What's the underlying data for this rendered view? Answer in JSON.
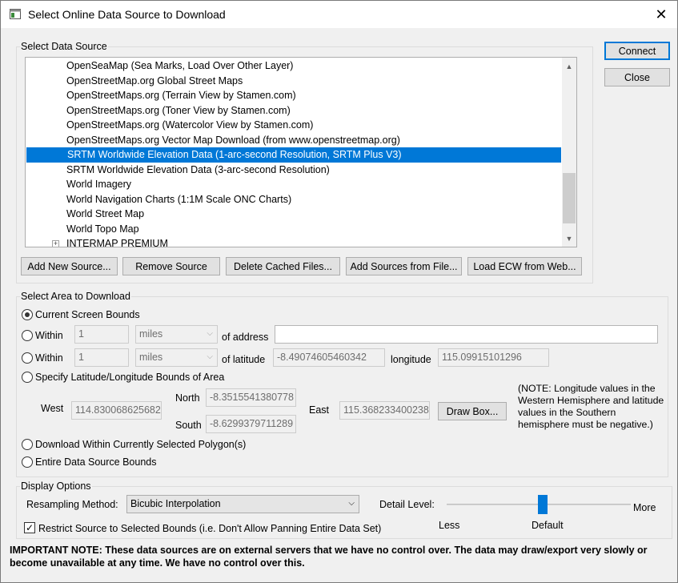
{
  "window": {
    "title": "Select Online Data Source to Download",
    "close_glyph": "✕",
    "icon": "app-window-icon"
  },
  "buttons": {
    "connect": "Connect",
    "close": "Close",
    "add_new_source": "Add New Source...",
    "remove_source": "Remove Source",
    "delete_cached": "Delete Cached Files...",
    "add_from_file": "Add Sources from File...",
    "load_ecw": "Load ECW from Web...",
    "draw_box": "Draw Box..."
  },
  "data_source": {
    "label": "Select Data Source",
    "items": [
      "OpenSeaMap (Sea Marks, Load Over Other Layer)",
      "OpenStreetMap.org Global Street Maps",
      "OpenStreetMaps.org (Terrain View by Stamen.com)",
      "OpenStreetMaps.org (Toner View by Stamen.com)",
      "OpenStreetMaps.org (Watercolor View by Stamen.com)",
      "OpenStreetMaps.org Vector Map Download (from www.openstreetmap.org)",
      "SRTM Worldwide Elevation Data (1-arc-second Resolution, SRTM Plus V3)",
      "SRTM Worldwide Elevation Data (3-arc-second Resolution)",
      "World Imagery",
      "World Navigation Charts (1:1M Scale ONC Charts)",
      "World Street Map",
      "World Topo Map",
      "INTERMAP PREMIUM"
    ],
    "selected_index": 6,
    "tree_plus_glyph": "+",
    "scroll_up_glyph": "▲",
    "scroll_down_glyph": "▼"
  },
  "area": {
    "label": "Select Area to Download",
    "current_screen": "Current Screen Bounds",
    "within": "Within",
    "of_address": "of address",
    "of_latitude": "of latitude",
    "longitude_label": "longitude",
    "distance1": "1",
    "unit1": "miles",
    "address_value": "",
    "distance2": "1",
    "unit2": "miles",
    "latitude_value": "-8.49074605460342",
    "longitude_value": "115.09915101296",
    "specify_bounds": "Specify Latitude/Longitude Bounds of Area",
    "west_label": "West",
    "north_label": "North",
    "south_label": "South",
    "east_label": "East",
    "west_value": "114.830068625682",
    "north_value": "-8.3515541380778",
    "south_value": "-8.6299379711289",
    "east_value": "115.368233400238",
    "note": "(NOTE: Longitude values in the Western Hemisphere and latitude values in the Southern hemisphere must be negative.)",
    "polygons": "Download Within Currently Selected Polygon(s)",
    "entire": "Entire Data Source Bounds",
    "selected_option": "current_screen"
  },
  "display": {
    "label": "Display Options",
    "resampling_label": "Resampling Method:",
    "resampling_value": "Bicubic Interpolation",
    "detail_label": "Detail Level:",
    "less": "Less",
    "default": "Default",
    "more": "More",
    "detail_level_fraction": 0.52,
    "restrict_checked": true,
    "restrict_label": "Restrict Source to Selected Bounds (i.e. Don't Allow Panning Entire Data Set)",
    "check_glyph": "✓",
    "dropdown_glyph": "⌵"
  },
  "important_note": "IMPORTANT NOTE: These data sources are on external servers that we have no control over. The data may draw/export very slowly or become unavailable at any time. We have no control over this."
}
